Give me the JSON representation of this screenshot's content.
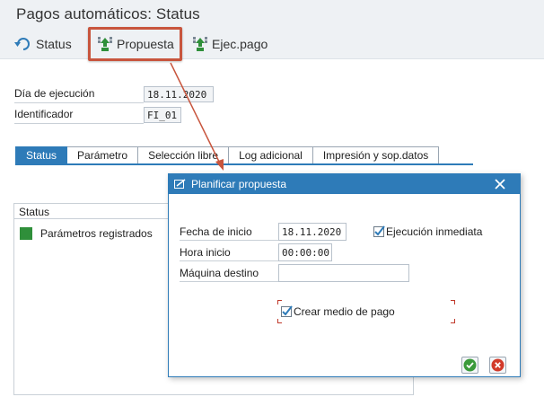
{
  "window": {
    "title": "Pagos automáticos: Status"
  },
  "toolbar": {
    "status_label": "Status",
    "propuesta_label": "Propuesta",
    "ejec_label": "Ejec.pago"
  },
  "header_fields": {
    "dia_label": "Día de ejecución",
    "dia_value": "18.11.2020",
    "ident_label": "Identificador",
    "ident_value": "FI_01"
  },
  "tabs": [
    {
      "label": "Status",
      "active": true
    },
    {
      "label": "Parámetro",
      "active": false
    },
    {
      "label": "Selección libre",
      "active": false
    },
    {
      "label": "Log adicional",
      "active": false
    },
    {
      "label": "Impresión y sop.datos",
      "active": false
    }
  ],
  "status_panel": {
    "header": "Status",
    "item_label": "Parámetros registrados"
  },
  "dialog": {
    "title": "Planificar propuesta",
    "fecha_label": "Fecha de inicio",
    "fecha_value": "18.11.2020",
    "hora_label": "Hora inicio",
    "hora_value": "00:00:00",
    "maquina_label": "Máquina destino",
    "maquina_value": "",
    "ejecucion_label": "Ejecución inmediata",
    "ejecucion_checked": true,
    "crear_label": "Crear medio de pago",
    "crear_checked": true
  },
  "colors": {
    "accent": "#2e7bb8",
    "status_green": "#2f8f3a",
    "highlight": "#c8553d",
    "confirm_green": "#3a9a3a",
    "cancel_red": "#d23a2a"
  }
}
